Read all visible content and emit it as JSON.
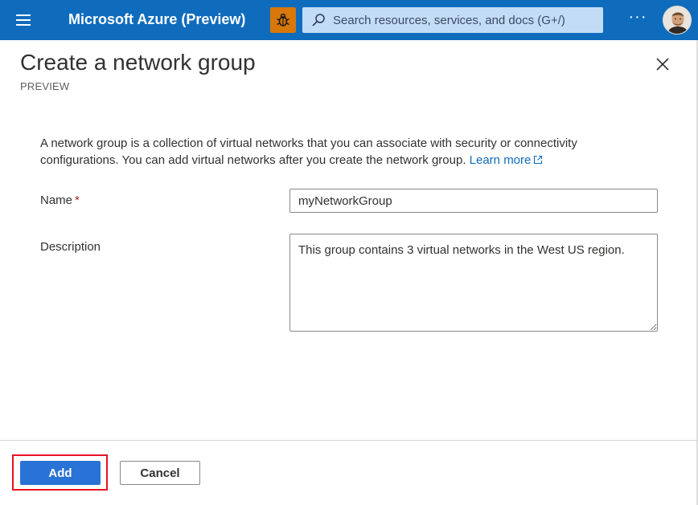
{
  "topbar": {
    "brand": "Microsoft Azure (Preview)",
    "search_placeholder": "Search resources, services, and docs (G+/)",
    "more_label": "···",
    "colors": {
      "bar": "#0f6cbd",
      "bug_button": "#d8770a",
      "search_bg": "#c3dcf5"
    },
    "icons": [
      "hamburger-menu-icon",
      "bug-icon",
      "search-icon",
      "more-icon",
      "avatar"
    ]
  },
  "panel": {
    "title": "Create a network group",
    "subtitle": "PREVIEW",
    "intro_text": "A network group is a collection of virtual networks that you can associate with security or connectivity configurations. You can add virtual networks after you create the network group.",
    "learn_more": "Learn more",
    "icons": [
      "close-icon",
      "external-link-icon"
    ]
  },
  "form": {
    "name_label": "Name",
    "required_marker": "*",
    "name_value": "myNetworkGroup",
    "description_label": "Description",
    "description_value": "This group contains 3 virtual networks in the West US region."
  },
  "footer": {
    "add_label": "Add",
    "cancel_label": "Cancel",
    "colors": {
      "add_button": "#2a73d6",
      "highlight": "#e81123"
    }
  }
}
